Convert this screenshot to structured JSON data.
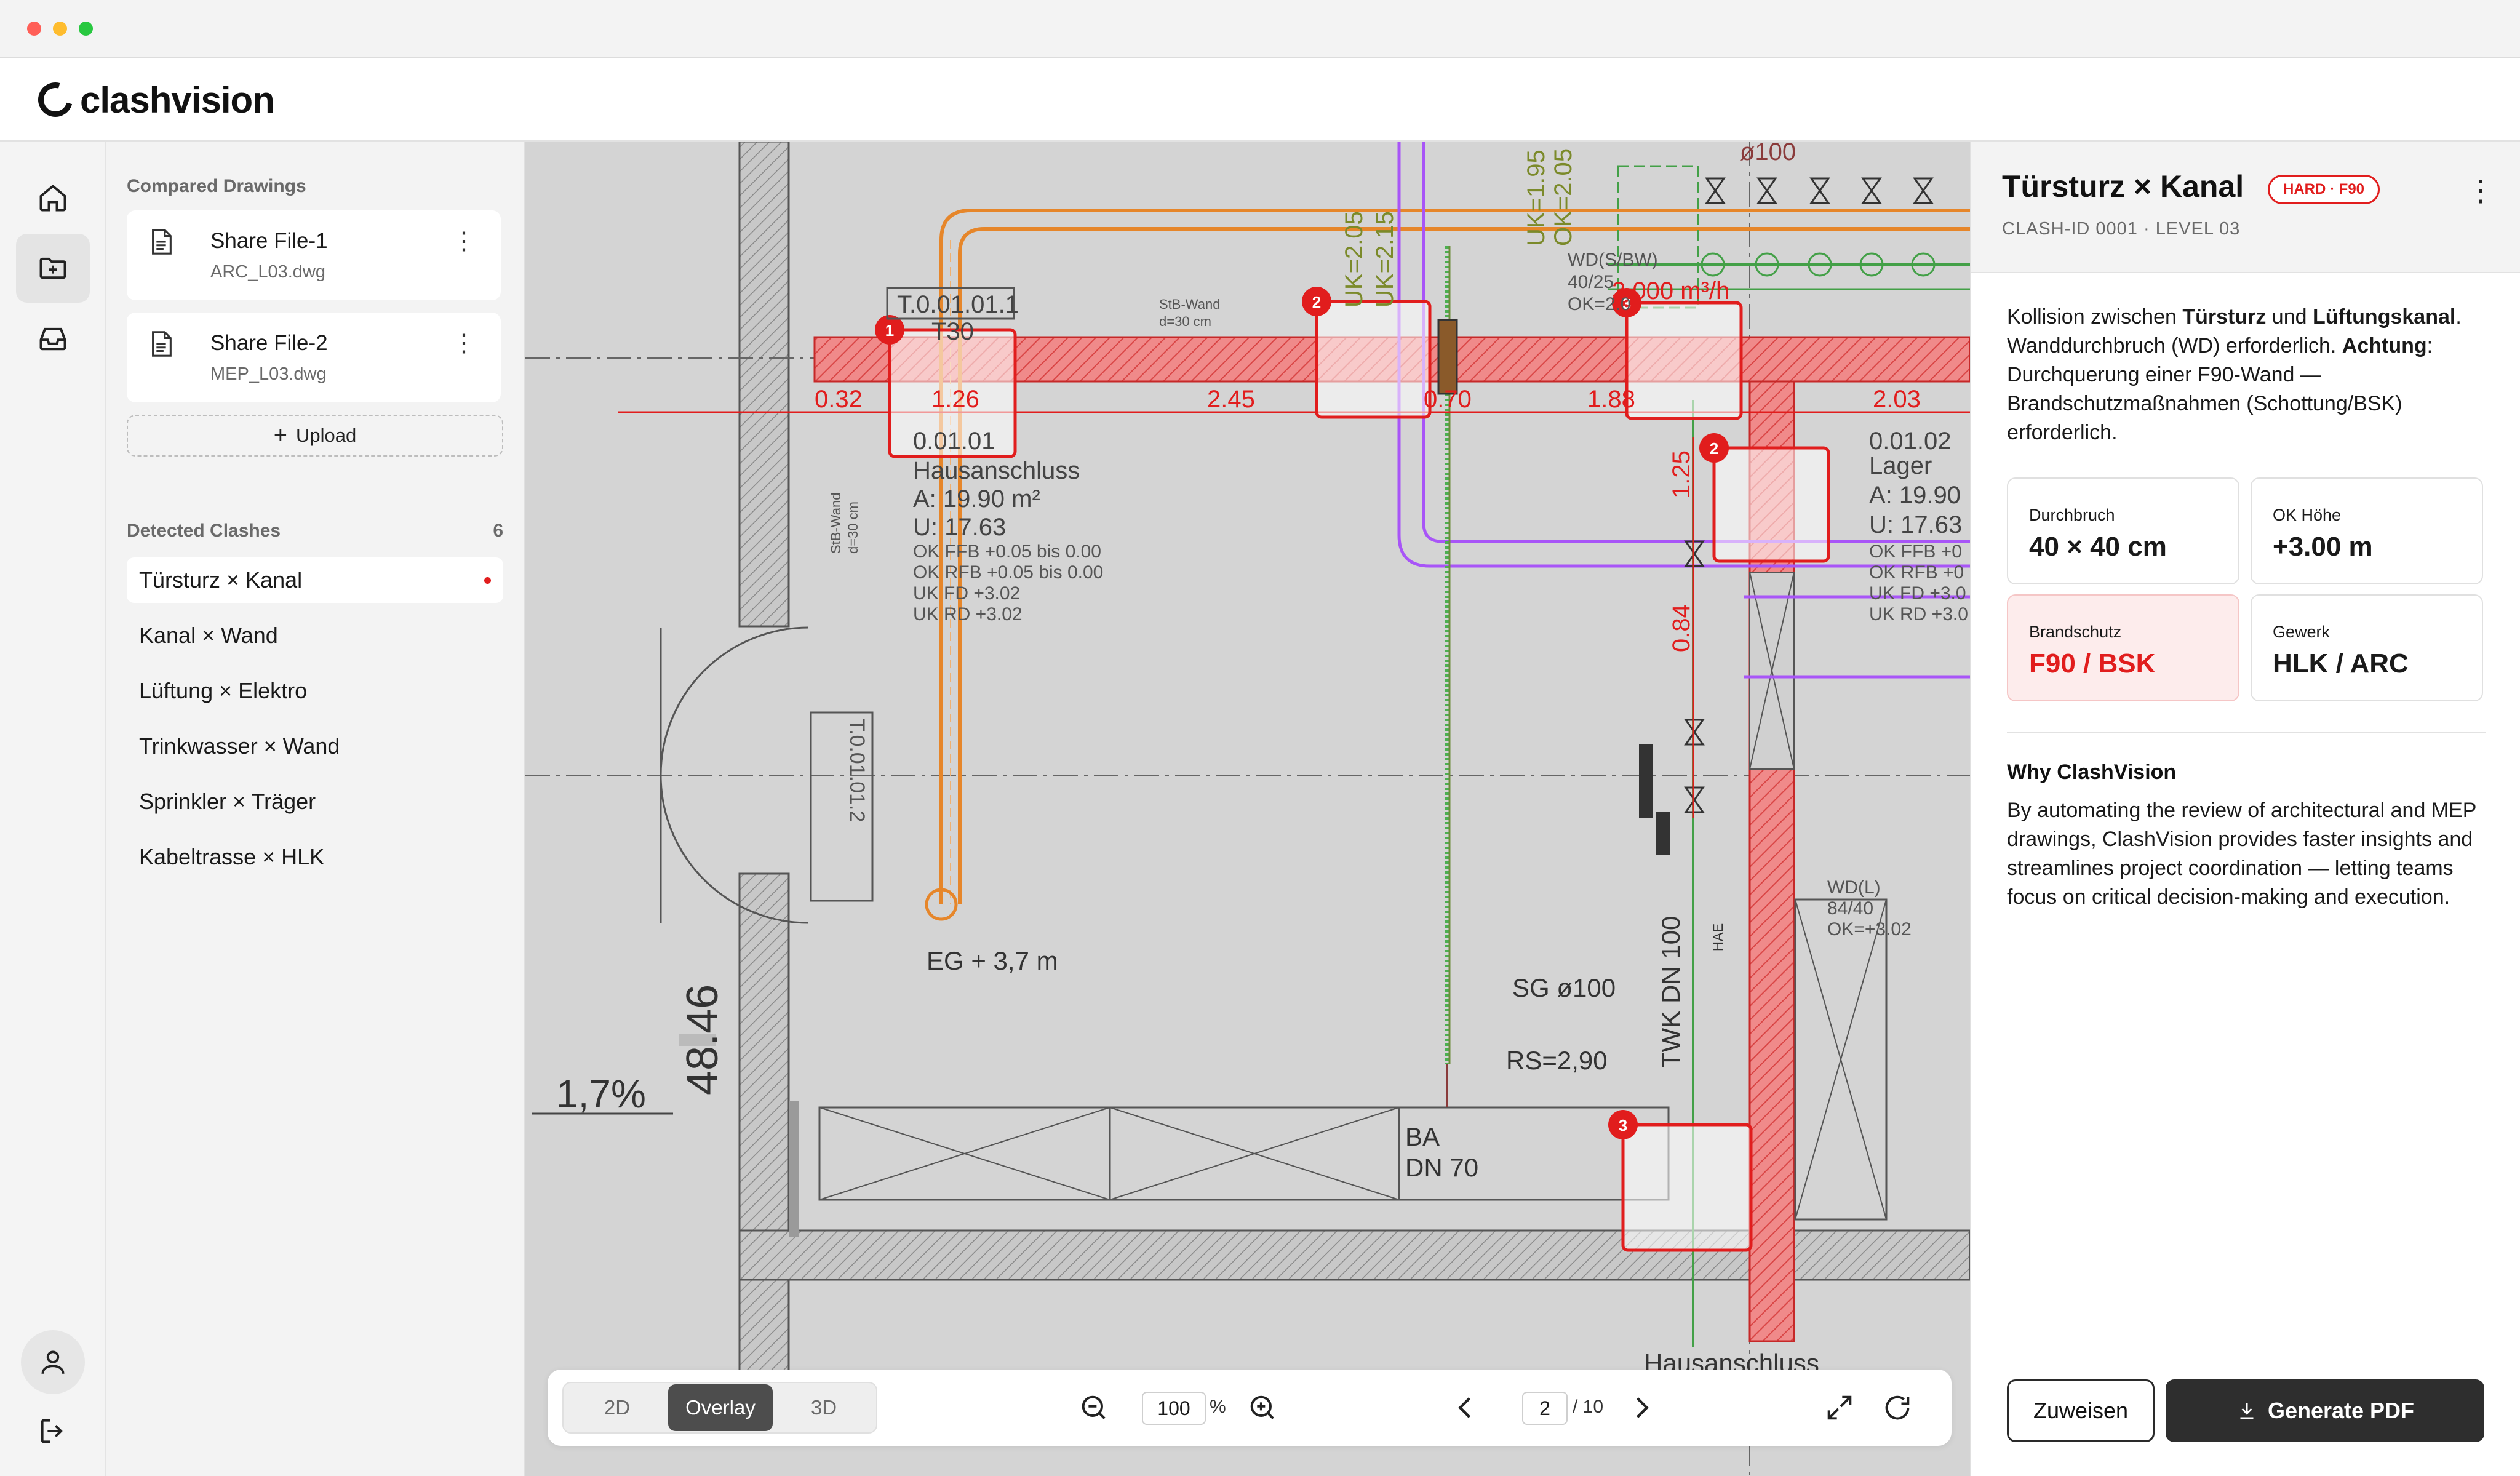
{
  "app": {
    "name": "clashvision"
  },
  "rail": {
    "items": [
      {
        "icon": "home-icon"
      },
      {
        "icon": "folder-plus-icon",
        "active": true
      },
      {
        "icon": "inbox-icon"
      }
    ],
    "bottom": [
      {
        "icon": "user-icon"
      },
      {
        "icon": "logout-icon"
      }
    ]
  },
  "sidebar": {
    "compared_title": "Compared Drawings",
    "files": [
      {
        "name": "Share File-1",
        "file": "ARC_L03.dwg"
      },
      {
        "name": "Share File-2",
        "file": "MEP_L03.dwg"
      }
    ],
    "upload_label": "Upload",
    "clashes_title": "Detected Clashes",
    "clashes_count": "6",
    "clashes": [
      {
        "label": "Türsturz × Kanal",
        "active": true
      },
      {
        "label": "Kanal × Wand"
      },
      {
        "label": "Lüftung × Elektro"
      },
      {
        "label": "Trinkwasser × Wand"
      },
      {
        "label": "Sprinkler × Träger"
      },
      {
        "label": "Kabeltrasse × HLK"
      }
    ]
  },
  "drawing": {
    "labels": {
      "room1": "T.0.01.01.1",
      "room1b": "T30",
      "room1id": "0.01.01",
      "room1name": "Hausanschluss",
      "room1area": "A: 19.90 m²",
      "room1u": "U: 17.63",
      "room1ok1": "OK FFB +0.05 bis 0.00",
      "room1ok2": "OK RFB +0.05 bis 0.00",
      "room1uk1": "UK FD +3.02",
      "room1uk2": "UK RD +3.02",
      "room2id": "0.01.02",
      "room2name": "Lager",
      "room2area": "A: 19.90",
      "room2u": "U: 17.63",
      "room2ok1": "OK FFB +0",
      "room2ok2": "OK RFB +0",
      "room2uk1": "UK FD +3.0",
      "room2uk2": "UK RD +3.0",
      "wall_a": "StB-Wand",
      "wall_a2": "d=30 cm",
      "wall_b": "StB-Wand",
      "wall_b2": "d=30 cm",
      "door2": "T.0.01.01.2",
      "dim1": "0.32",
      "dim2": "1.26",
      "dim3": "2.45",
      "dim4": "0.70",
      "dim5": "1.88",
      "dim6": "2.03",
      "dim7": "1.25",
      "dim8": "0.84",
      "uk1": "UK=2.05",
      "uk2": "UK=2.15",
      "uk3": "UK=1.95",
      "ok3": "OK=2.05",
      "wd1": "WD(S/BW)",
      "wd1b": "40/25",
      "wd1c": "OK=2.0",
      "flow": "3.000 m³/h",
      "pipe": "ø100",
      "wd2": "WD(L)",
      "wd2b": "84/40",
      "wd2c": "OK=+3.02",
      "eg": "EG + 3,7 m",
      "sg": "SG ø100",
      "rs": "RS=2,90",
      "ba": "BA",
      "ba2": "DN 70",
      "twk": "TWK DN 100",
      "hae": "HAE",
      "slope": "1,7%",
      "elev": "48.46",
      "hausanschluss": "Hausanschluss"
    },
    "markers": [
      "1",
      "2",
      "3",
      "2",
      "3"
    ]
  },
  "toolbar": {
    "modes": [
      "2D",
      "Overlay",
      "3D"
    ],
    "active_mode": "Overlay",
    "zoom": "100",
    "zoom_unit": "%",
    "page": "2",
    "page_total": "/ 10"
  },
  "detail": {
    "title": "Türsturz × Kanal",
    "badge": "HARD · F90",
    "subtitle": "CLASH-ID 0001 · LEVEL 03",
    "desc": {
      "p1": "Kollision zwischen ",
      "b1": "Türsturz",
      "p2": " und ",
      "b2": "Lüftungskanal",
      "p3": ". Wanddurchbruch (WD) erforderlich. ",
      "b3": "Achtung",
      "p4": ": Durchquerung einer F90-Wand — Brandschutzmaßnahmen (Schottung/BSK) erforderlich."
    },
    "metrics": [
      {
        "label": "Durchbruch",
        "value": "40 × 40 cm"
      },
      {
        "label": "OK Höhe",
        "value": "+3.00 m"
      },
      {
        "label": "Brandschutz",
        "value": "F90 / BSK",
        "warn": true
      },
      {
        "label": "Gewerk",
        "value": "HLK / ARC"
      }
    ],
    "why_title": "Why ClashVision",
    "why_text": "By automating the review of architectural and MEP drawings, ClashVision provides faster insights and streamlines project coordination — letting teams focus on critical decision-making and execution.",
    "assign_label": "Zuweisen",
    "pdf_label": "Generate PDF"
  },
  "colors": {
    "accent_red": "#e11d1d",
    "dark_button": "#2e2e2e"
  }
}
